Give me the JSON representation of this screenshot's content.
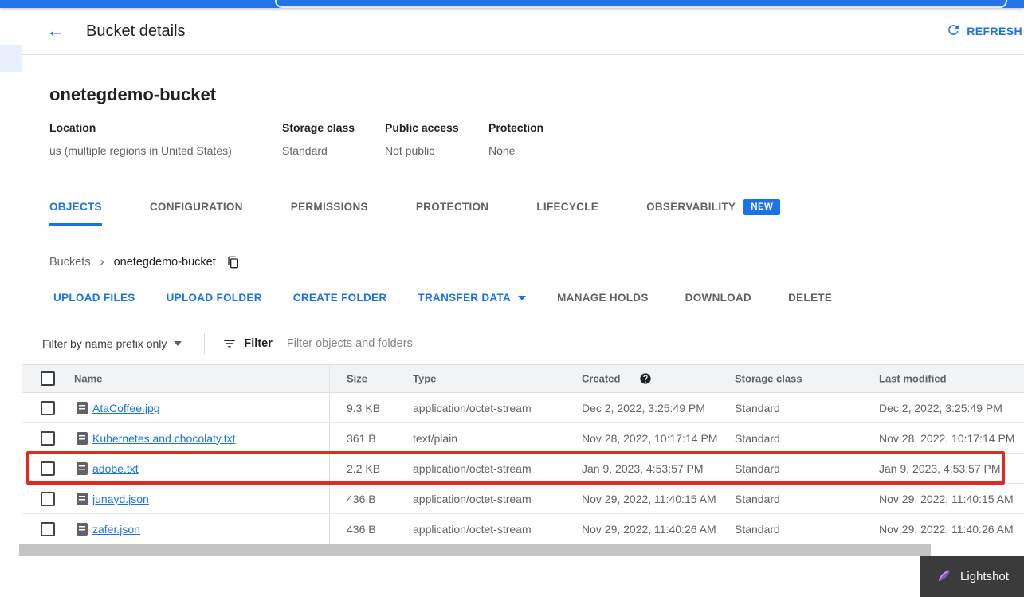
{
  "header": {
    "back_icon": "←",
    "title": "Bucket details",
    "refresh": "REFRESH"
  },
  "bucket": {
    "name": "onetegdemo-bucket",
    "meta": [
      {
        "label": "Location",
        "value": "us (multiple regions in United States)"
      },
      {
        "label": "Storage class",
        "value": "Standard"
      },
      {
        "label": "Public access",
        "value": "Not public"
      },
      {
        "label": "Protection",
        "value": "None"
      }
    ]
  },
  "tabs": [
    {
      "label": "OBJECTS",
      "active": true
    },
    {
      "label": "CONFIGURATION",
      "active": false
    },
    {
      "label": "PERMISSIONS",
      "active": false
    },
    {
      "label": "PROTECTION",
      "active": false
    },
    {
      "label": "LIFECYCLE",
      "active": false
    },
    {
      "label": "OBSERVABILITY",
      "active": false,
      "badge": "NEW"
    }
  ],
  "breadcrumb": {
    "root": "Buckets",
    "separator": "›",
    "current": "onetegdemo-bucket"
  },
  "actions": {
    "upload_files": "UPLOAD FILES",
    "upload_folder": "UPLOAD FOLDER",
    "create_folder": "CREATE FOLDER",
    "transfer_data": "TRANSFER DATA",
    "manage_holds": "MANAGE HOLDS",
    "download": "DOWNLOAD",
    "delete": "DELETE"
  },
  "filter": {
    "scope": "Filter by name prefix only",
    "label": "Filter",
    "placeholder": "Filter objects and folders"
  },
  "table": {
    "columns": [
      "Name",
      "Size",
      "Type",
      "Created",
      "Storage class",
      "Last modified"
    ],
    "rows": [
      {
        "name": "AtaCoffee.jpg",
        "size": "9.3 KB",
        "type": "application/octet-stream",
        "created": "Dec 2, 2022, 3:25:49 PM",
        "storage_class": "Standard",
        "last_modified": "Dec 2, 2022, 3:25:49 PM",
        "highlighted": false
      },
      {
        "name": "Kubernetes and chocolaty.txt",
        "size": "361 B",
        "type": "text/plain",
        "created": "Nov 28, 2022, 10:17:14 PM",
        "storage_class": "Standard",
        "last_modified": "Nov 28, 2022, 10:17:14 PM",
        "highlighted": false
      },
      {
        "name": "adobe.txt",
        "size": "2.2 KB",
        "type": "application/octet-stream",
        "created": "Jan 9, 2023, 4:53:57 PM",
        "storage_class": "Standard",
        "last_modified": "Jan 9, 2023, 4:53:57 PM",
        "highlighted": true
      },
      {
        "name": "junayd.json",
        "size": "436 B",
        "type": "application/octet-stream",
        "created": "Nov 29, 2022, 11:40:15 AM",
        "storage_class": "Standard",
        "last_modified": "Nov 29, 2022, 11:40:15 AM",
        "highlighted": false
      },
      {
        "name": "zafer.json",
        "size": "436 B",
        "type": "application/octet-stream",
        "created": "Nov 29, 2022, 11:40:26 AM",
        "storage_class": "Standard",
        "last_modified": "Nov 29, 2022, 11:40:26 AM",
        "highlighted": false
      }
    ]
  },
  "watermark": {
    "label": "Lightshot"
  },
  "colors": {
    "accent": "#1a73e8",
    "topbar": "#2374e8",
    "highlight_red": "#e8261d",
    "badge_bg": "#1a73e8",
    "link": "#1a73e8",
    "table_header_bg": "#f1f3f4"
  }
}
